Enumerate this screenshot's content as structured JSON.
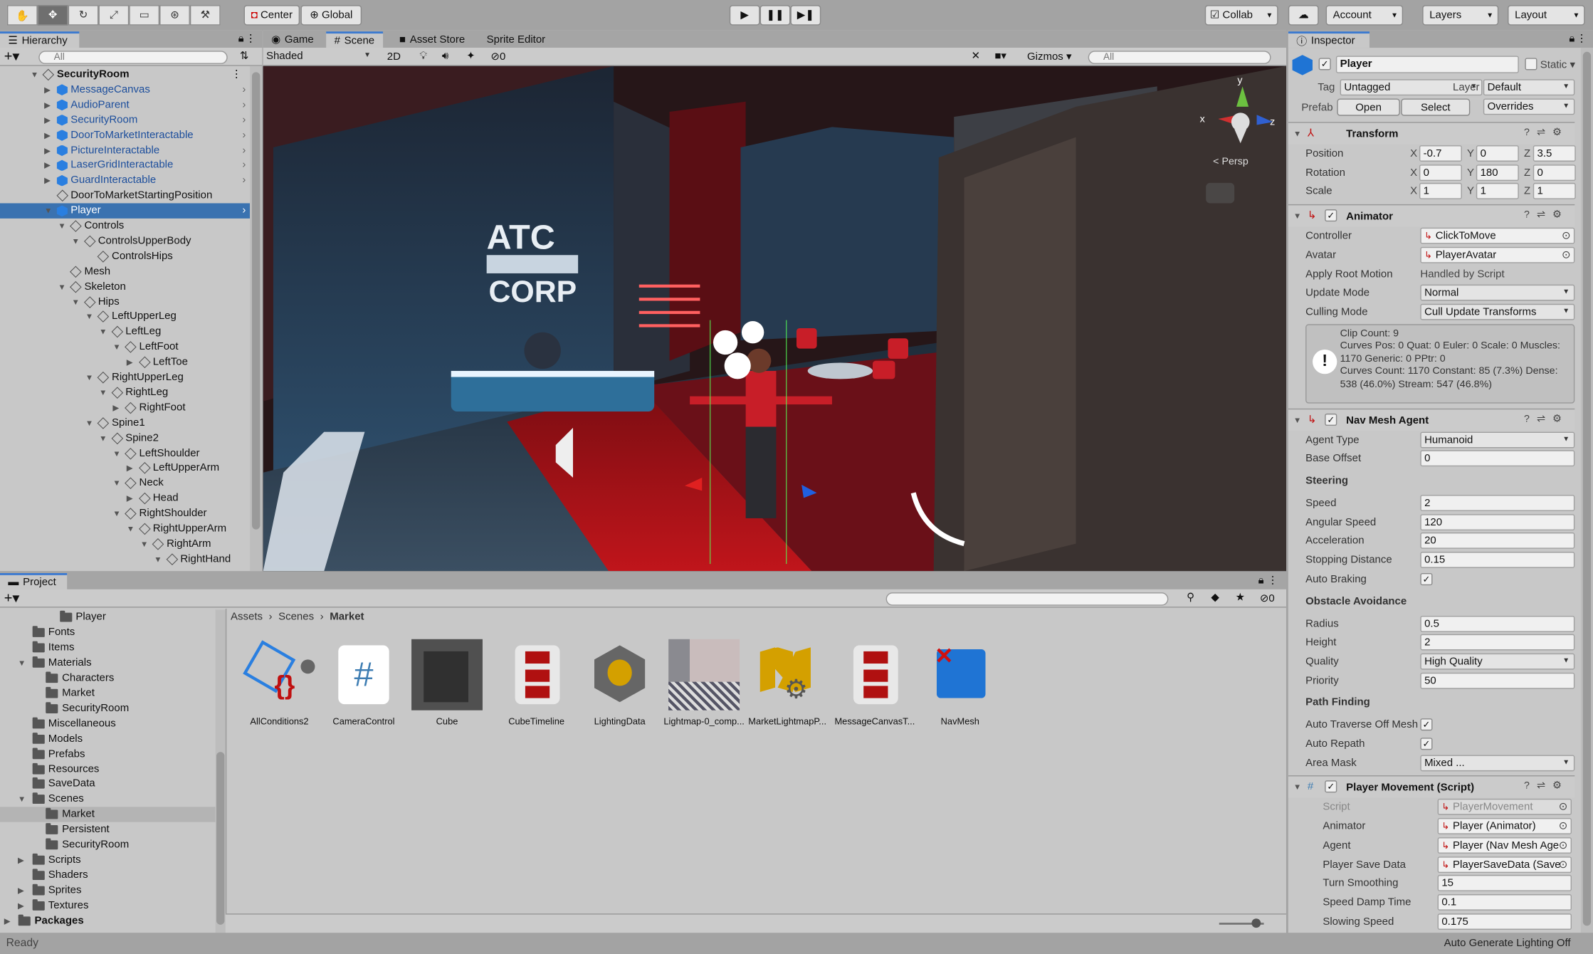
{
  "toolbar": {
    "tools": [
      "hand-tool",
      "move-tool",
      "rotate-tool",
      "scale-tool",
      "rect-tool",
      "transform-tool",
      "custom-tool"
    ],
    "pivot": "Center",
    "space": "Global",
    "collab": "Collab",
    "account": "Account",
    "layers": "Layers",
    "layout": "Layout"
  },
  "hierarchy": {
    "tab": "Hierarchy",
    "search_placeholder": "All",
    "items": [
      {
        "label": "SecurityRoom",
        "level": 0,
        "arrow": "open",
        "type": "scene"
      },
      {
        "label": "MessageCanvas",
        "level": 1,
        "arrow": "closed",
        "type": "prefab",
        "more": true
      },
      {
        "label": "AudioParent",
        "level": 1,
        "arrow": "closed",
        "type": "prefab",
        "more": true
      },
      {
        "label": "SecurityRoom",
        "level": 1,
        "arrow": "closed",
        "type": "prefab",
        "more": true
      },
      {
        "label": "DoorToMarketInteractable",
        "level": 1,
        "arrow": "closed",
        "type": "prefab",
        "more": true
      },
      {
        "label": "PictureInteractable",
        "level": 1,
        "arrow": "closed",
        "type": "prefab",
        "more": true
      },
      {
        "label": "LaserGridInteractable",
        "level": 1,
        "arrow": "closed",
        "type": "prefab",
        "more": true
      },
      {
        "label": "GuardInteractable",
        "level": 1,
        "arrow": "closed",
        "type": "prefab",
        "more": true
      },
      {
        "label": "DoorToMarketStartingPosition",
        "level": 1,
        "arrow": "none",
        "type": "object"
      },
      {
        "label": "Player",
        "level": 1,
        "arrow": "open",
        "type": "prefab",
        "selected": true,
        "more": true
      },
      {
        "label": "Controls",
        "level": 2,
        "arrow": "open",
        "type": "child"
      },
      {
        "label": "ControlsUpperBody",
        "level": 3,
        "arrow": "open",
        "type": "child"
      },
      {
        "label": "ControlsHips",
        "level": 4,
        "arrow": "none",
        "type": "child"
      },
      {
        "label": "Mesh",
        "level": 2,
        "arrow": "none",
        "type": "child"
      },
      {
        "label": "Skeleton",
        "level": 2,
        "arrow": "open",
        "type": "child"
      },
      {
        "label": "Hips",
        "level": 3,
        "arrow": "open",
        "type": "child"
      },
      {
        "label": "LeftUpperLeg",
        "level": 4,
        "arrow": "open",
        "type": "child"
      },
      {
        "label": "LeftLeg",
        "level": 5,
        "arrow": "open",
        "type": "child"
      },
      {
        "label": "LeftFoot",
        "level": 6,
        "arrow": "open",
        "type": "child"
      },
      {
        "label": "LeftToe",
        "level": 7,
        "arrow": "closed",
        "type": "child"
      },
      {
        "label": "RightUpperLeg",
        "level": 4,
        "arrow": "open",
        "type": "child"
      },
      {
        "label": "RightLeg",
        "level": 5,
        "arrow": "open",
        "type": "child"
      },
      {
        "label": "RightFoot",
        "level": 6,
        "arrow": "closed",
        "type": "child"
      },
      {
        "label": "Spine1",
        "level": 4,
        "arrow": "open",
        "type": "child"
      },
      {
        "label": "Spine2",
        "level": 5,
        "arrow": "open",
        "type": "child"
      },
      {
        "label": "LeftShoulder",
        "level": 6,
        "arrow": "open",
        "type": "child"
      },
      {
        "label": "LeftUpperArm",
        "level": 7,
        "arrow": "closed",
        "type": "child"
      },
      {
        "label": "Neck",
        "level": 6,
        "arrow": "open",
        "type": "child"
      },
      {
        "label": "Head",
        "level": 7,
        "arrow": "closed",
        "type": "child"
      },
      {
        "label": "RightShoulder",
        "level": 6,
        "arrow": "open",
        "type": "child"
      },
      {
        "label": "RightUpperArm",
        "level": 7,
        "arrow": "open",
        "type": "child"
      },
      {
        "label": "RightArm",
        "level": 8,
        "arrow": "open",
        "type": "child"
      },
      {
        "label": "RightHand",
        "level": 9,
        "arrow": "open",
        "type": "child"
      }
    ]
  },
  "scene": {
    "tabs": [
      "Game",
      "Scene",
      "Asset Store",
      "Sprite Editor"
    ],
    "active_tab": "Scene",
    "draw_mode": "Shaded",
    "mode_2d": "2D",
    "hidden_count": "0",
    "gizmos": "Gizmos",
    "search_placeholder": "All",
    "persp": "< Persp",
    "sign_logo": [
      "ATC",
      "CORP"
    ],
    "gizmo_axes": [
      "x",
      "y",
      "z"
    ]
  },
  "inspector": {
    "tab": "Inspector",
    "name": "Player",
    "static": "Static",
    "tag_label": "Tag",
    "tag": "Untagged",
    "layer_label": "Layer",
    "layer": "Default",
    "prefab_label": "Prefab",
    "open": "Open",
    "select": "Select",
    "overrides": "Overrides",
    "rows": [
      {
        "k": "hdr",
        "t": "Transform",
        "icon": "transform-icon",
        "check": false
      },
      {
        "k": "xyz",
        "l": "Position",
        "v": [
          "-0.7",
          "0",
          "3.5"
        ]
      },
      {
        "k": "xyz",
        "l": "Rotation",
        "v": [
          "0",
          "180",
          "0"
        ]
      },
      {
        "k": "xyz",
        "l": "Scale",
        "v": [
          "1",
          "1",
          "1"
        ]
      },
      {
        "k": "hdr",
        "t": "Animator",
        "icon": "animator-icon",
        "check": true
      },
      {
        "k": "obj",
        "l": "Controller",
        "v": "ClickToMove"
      },
      {
        "k": "obj",
        "l": "Avatar",
        "v": "PlayerAvatar"
      },
      {
        "k": "text",
        "l": "Apply Root Motion",
        "v": "Handled by Script"
      },
      {
        "k": "dd",
        "l": "Update Mode",
        "v": "Normal"
      },
      {
        "k": "dd",
        "l": "Culling Mode",
        "v": "Cull Update Transforms"
      },
      {
        "k": "info",
        "v": "Clip Count: 9\nCurves Pos: 0 Quat: 0 Euler: 0 Scale: 0 Muscles: 1170 Generic: 0 PPtr: 0\nCurves Count: 1170 Constant: 85 (7.3%) Dense: 538 (46.0%) Stream: 547 (46.8%)"
      },
      {
        "k": "hdr",
        "t": "Nav Mesh Agent",
        "icon": "nav-mesh-agent-icon",
        "check": true
      },
      {
        "k": "dd",
        "l": "Agent Type",
        "v": "Humanoid"
      },
      {
        "k": "field",
        "l": "Base Offset",
        "v": "0"
      },
      {
        "k": "sec",
        "l": "Steering"
      },
      {
        "k": "field",
        "l": "Speed",
        "v": "2"
      },
      {
        "k": "field",
        "l": "Angular Speed",
        "v": "120"
      },
      {
        "k": "field",
        "l": "Acceleration",
        "v": "20"
      },
      {
        "k": "field",
        "l": "Stopping Distance",
        "v": "0.15"
      },
      {
        "k": "check",
        "l": "Auto Braking",
        "v": true
      },
      {
        "k": "sec",
        "l": "Obstacle Avoidance"
      },
      {
        "k": "field",
        "l": "Radius",
        "v": "0.5"
      },
      {
        "k": "field",
        "l": "Height",
        "v": "2"
      },
      {
        "k": "dd",
        "l": "Quality",
        "v": "High Quality"
      },
      {
        "k": "field",
        "l": "Priority",
        "v": "50"
      },
      {
        "k": "sec",
        "l": "Path Finding"
      },
      {
        "k": "check",
        "l": "Auto Traverse Off Mesh",
        "v": true
      },
      {
        "k": "check",
        "l": "Auto Repath",
        "v": true
      },
      {
        "k": "dd",
        "l": "Area Mask",
        "v": "Mixed ..."
      },
      {
        "k": "hdr",
        "t": "Player Movement (Script)",
        "icon": "script-icon",
        "check": true
      },
      {
        "k": "obj2",
        "l": "Script",
        "v": "PlayerMovement",
        "disabled": true
      },
      {
        "k": "obj2",
        "l": "Animator",
        "v": "Player (Animator)"
      },
      {
        "k": "obj2",
        "l": "Agent",
        "v": "Player (Nav Mesh Age"
      },
      {
        "k": "obj2",
        "l": "Player Save Data",
        "v": "PlayerSaveData (Save"
      },
      {
        "k": "field2",
        "l": "Turn Smoothing",
        "v": "15"
      },
      {
        "k": "field2",
        "l": "Speed Damp Time",
        "v": "0.1"
      },
      {
        "k": "field2",
        "l": "Slowing Speed",
        "v": "0.175"
      }
    ]
  },
  "project": {
    "tab": "Project",
    "hidden_count": "0",
    "breadcrumb": [
      "Assets",
      "Scenes",
      "Market"
    ],
    "tree": [
      {
        "label": "Player",
        "level": 3,
        "arrow": "none"
      },
      {
        "label": "Fonts",
        "level": 1,
        "arrow": "none"
      },
      {
        "label": "Items",
        "level": 1,
        "arrow": "none"
      },
      {
        "label": "Materials",
        "level": 1,
        "arrow": "open"
      },
      {
        "label": "Characters",
        "level": 2,
        "arrow": "none"
      },
      {
        "label": "Market",
        "level": 2,
        "arrow": "none"
      },
      {
        "label": "SecurityRoom",
        "level": 2,
        "arrow": "none"
      },
      {
        "label": "Miscellaneous",
        "level": 1,
        "arrow": "none"
      },
      {
        "label": "Models",
        "level": 1,
        "arrow": "none"
      },
      {
        "label": "Prefabs",
        "level": 1,
        "arrow": "none"
      },
      {
        "label": "Resources",
        "level": 1,
        "arrow": "none"
      },
      {
        "label": "SaveData",
        "level": 1,
        "arrow": "none"
      },
      {
        "label": "Scenes",
        "level": 1,
        "arrow": "open"
      },
      {
        "label": "Market",
        "level": 2,
        "arrow": "none",
        "selected": true
      },
      {
        "label": "Persistent",
        "level": 2,
        "arrow": "none"
      },
      {
        "label": "SecurityRoom",
        "level": 2,
        "arrow": "none"
      },
      {
        "label": "Scripts",
        "level": 1,
        "arrow": "closed"
      },
      {
        "label": "Shaders",
        "level": 1,
        "arrow": "none"
      },
      {
        "label": "Sprites",
        "level": 1,
        "arrow": "closed"
      },
      {
        "label": "Textures",
        "level": 1,
        "arrow": "closed"
      },
      {
        "label": "Packages",
        "level": 0,
        "arrow": "closed",
        "bold": true
      }
    ],
    "assets": [
      {
        "label": "AllConditions2",
        "icon": "scriptable-object-icon"
      },
      {
        "label": "CameraControl",
        "icon": "csharp-script-icon"
      },
      {
        "label": "Cube",
        "icon": "mesh-cube-icon"
      },
      {
        "label": "CubeTimeline",
        "icon": "timeline-icon"
      },
      {
        "label": "LightingData",
        "icon": "lighting-data-icon"
      },
      {
        "label": "Lightmap-0_comp...",
        "icon": "lightmap-texture-icon"
      },
      {
        "label": "MarketLightmapP...",
        "icon": "lightmap-parameters-icon"
      },
      {
        "label": "MessageCanvasT...",
        "icon": "timeline-icon"
      },
      {
        "label": "NavMesh",
        "icon": "navmesh-icon"
      }
    ]
  },
  "status": {
    "left": "Ready",
    "right": "Auto Generate Lighting Off"
  },
  "colors": {
    "selection": "#3a72b0",
    "prefab_text": "#1c4e9c",
    "accent_tab": "#3a79d0",
    "carpet": "#b0141a"
  }
}
